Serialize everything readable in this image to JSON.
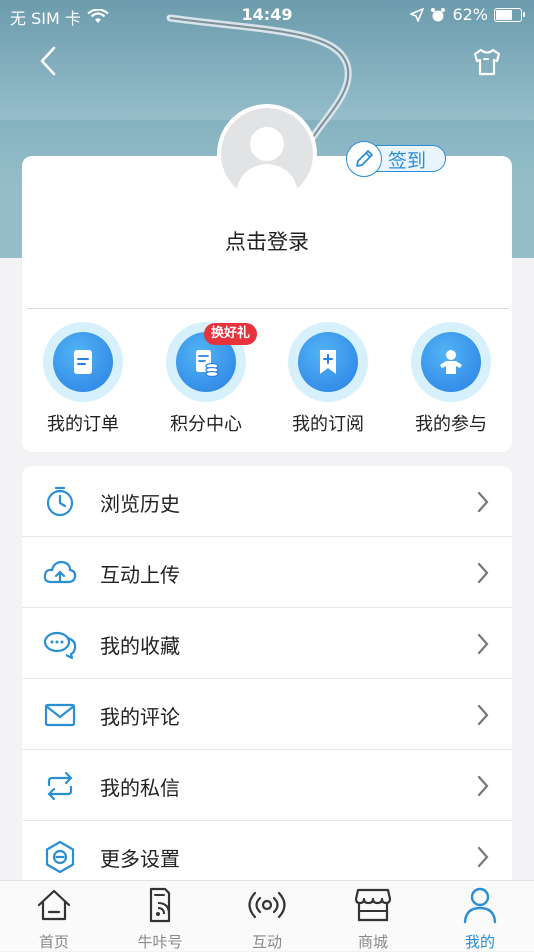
{
  "status_bar": {
    "carrier": "无 SIM 卡",
    "time": "14:49",
    "battery": "62%",
    "battery_level": 0.62
  },
  "profile": {
    "login_prompt": "点击登录",
    "checkin_label": "签到"
  },
  "quick_actions": [
    {
      "label": "我的订单",
      "icon": "order-icon"
    },
    {
      "label": "积分中心",
      "icon": "points-icon",
      "badge": "换好礼"
    },
    {
      "label": "我的订阅",
      "icon": "subscribe-icon"
    },
    {
      "label": "我的参与",
      "icon": "participate-icon"
    }
  ],
  "menu": [
    {
      "label": "浏览历史",
      "icon": "clock-icon"
    },
    {
      "label": "互动上传",
      "icon": "cloud-upload-icon"
    },
    {
      "label": "我的收藏",
      "icon": "chat-bubbles-icon"
    },
    {
      "label": "我的评论",
      "icon": "mail-icon"
    },
    {
      "label": "我的私信",
      "icon": "swap-arrows-icon"
    },
    {
      "label": "更多设置",
      "icon": "settings-hex-icon"
    }
  ],
  "tabbar": {
    "items": [
      {
        "label": "首页",
        "icon": "home-icon"
      },
      {
        "label": "牛咔号",
        "icon": "channel-icon"
      },
      {
        "label": "互动",
        "icon": "broadcast-icon"
      },
      {
        "label": "商城",
        "icon": "store-icon"
      },
      {
        "label": "我的",
        "icon": "person-icon"
      }
    ],
    "active_index": 4
  },
  "colors": {
    "accent": "#2b8fd6",
    "badge": "#e8323c"
  }
}
